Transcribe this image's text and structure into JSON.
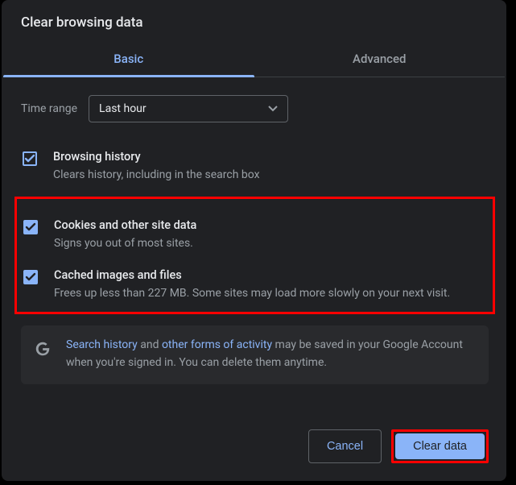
{
  "title": "Clear browsing data",
  "tabs": {
    "basic": "Basic",
    "advanced": "Advanced",
    "active": "basic"
  },
  "time_range": {
    "label": "Time range",
    "value": "Last hour"
  },
  "options": {
    "browsing_history": {
      "title": "Browsing history",
      "desc": "Clears history, including in the search box",
      "checked": true
    },
    "cookies": {
      "title": "Cookies and other site data",
      "desc": "Signs you out of most sites.",
      "checked": true
    },
    "cache": {
      "title": "Cached images and files",
      "desc": "Frees up less than 227 MB. Some sites may load more slowly on your next visit.",
      "checked": true
    }
  },
  "info": {
    "link1": "Search history",
    "mid1": " and ",
    "link2": "other forms of activity",
    "rest": " may be saved in your Google Account when you're signed in. You can delete them anytime."
  },
  "buttons": {
    "cancel": "Cancel",
    "clear": "Clear data"
  }
}
